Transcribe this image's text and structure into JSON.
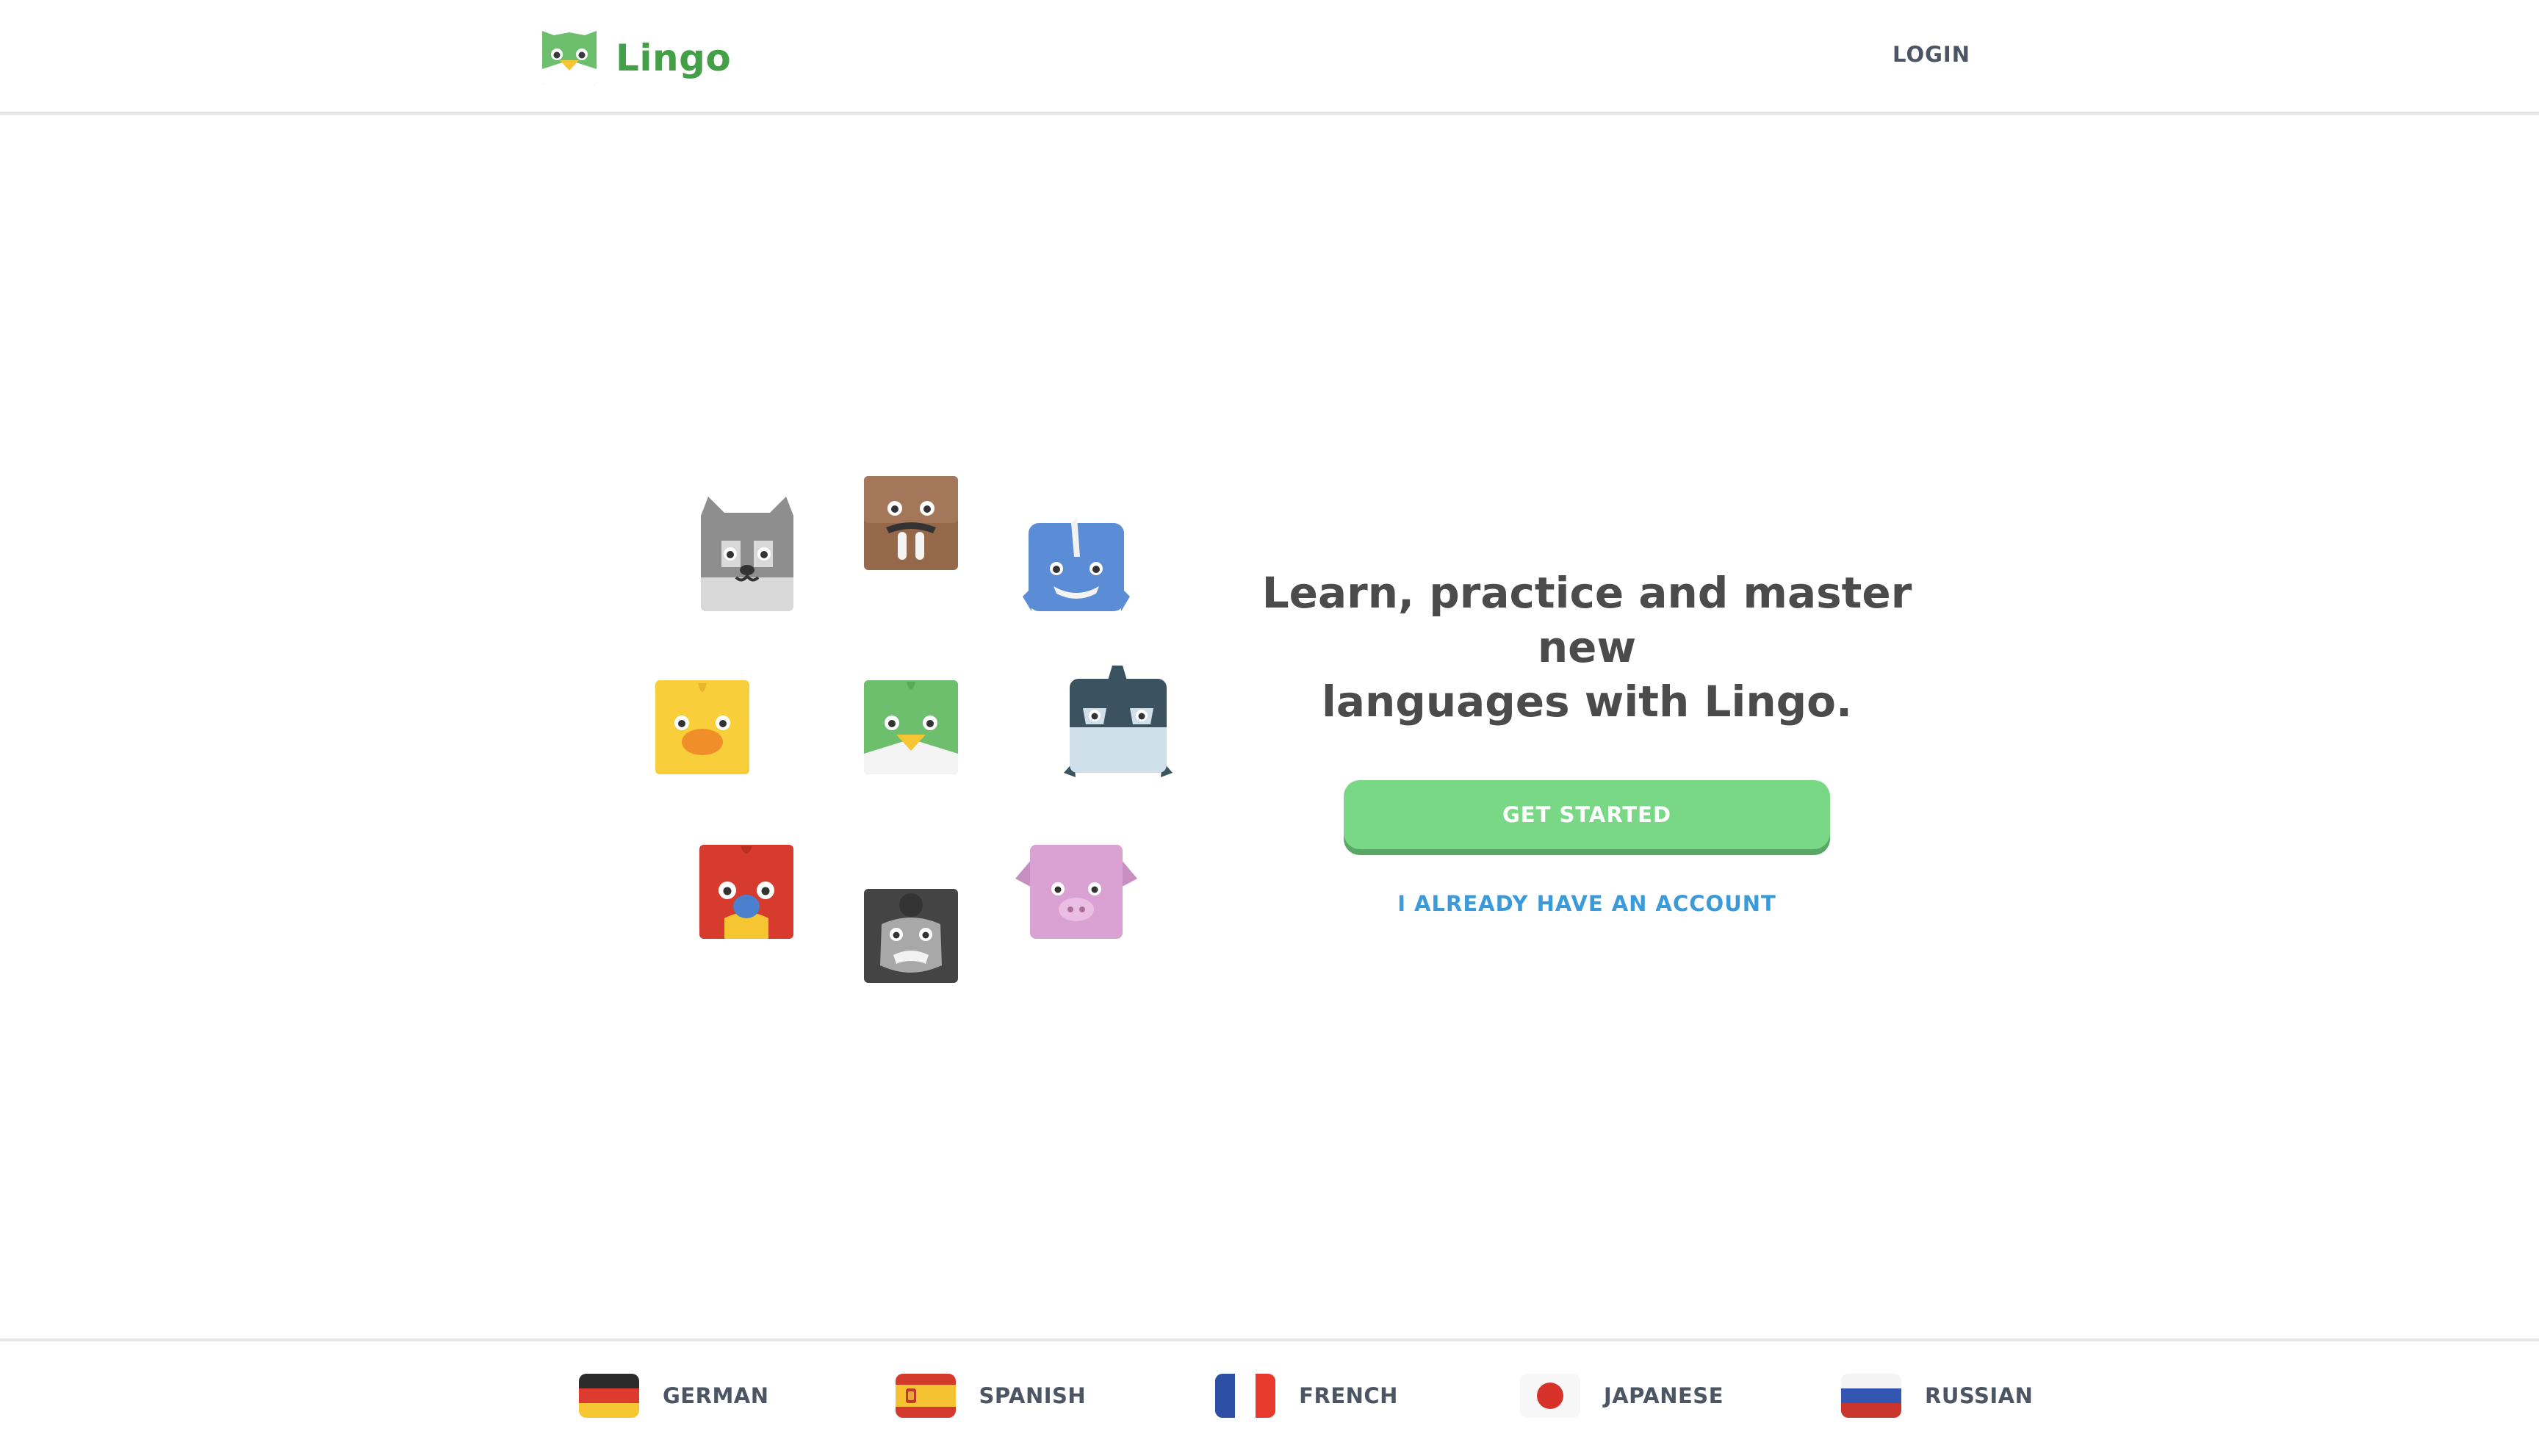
{
  "header": {
    "brand": "Lingo",
    "login_label": "LOGIN"
  },
  "hero": {
    "title_line1": "Learn, practice and master new",
    "title_line2": "languages with Lingo.",
    "primary_cta": "GET STARTED",
    "secondary_cta": "I ALREADY HAVE AN ACCOUNT"
  },
  "mascots": [
    {
      "animal": "wolf",
      "icon": "wolf-icon",
      "color": "#c9c9c9"
    },
    {
      "animal": "walrus",
      "icon": "walrus-icon",
      "color": "#96684a"
    },
    {
      "animal": "narwhal",
      "icon": "narwhal-icon",
      "color": "#5b8cd6"
    },
    {
      "animal": "duck",
      "icon": "duck-icon",
      "color": "#f8cf3a"
    },
    {
      "animal": "parrot",
      "icon": "parrot-icon",
      "color": "#6dbf6d"
    },
    {
      "animal": "orca",
      "icon": "orca-icon",
      "color": "#3b5360"
    },
    {
      "animal": "macaw",
      "icon": "macaw-icon",
      "color": "#d73b2e"
    },
    {
      "animal": "gorilla",
      "icon": "gorilla-icon",
      "color": "#444444"
    },
    {
      "animal": "pig",
      "icon": "pig-icon",
      "color": "#d9a2d2"
    }
  ],
  "footer": {
    "languages": [
      {
        "label": "GERMAN",
        "icon": "germany-flag-icon"
      },
      {
        "label": "SPANISH",
        "icon": "spain-flag-icon"
      },
      {
        "label": "FRENCH",
        "icon": "france-flag-icon"
      },
      {
        "label": "JAPANESE",
        "icon": "japan-flag-icon"
      },
      {
        "label": "RUSSIAN",
        "icon": "russia-flag-icon"
      }
    ]
  },
  "colors": {
    "brand_green": "#43a047",
    "cta_green": "#78d886",
    "link_blue": "#3b9ad9",
    "text_dark": "#4b4b4b",
    "text_nav": "#4b5563"
  }
}
